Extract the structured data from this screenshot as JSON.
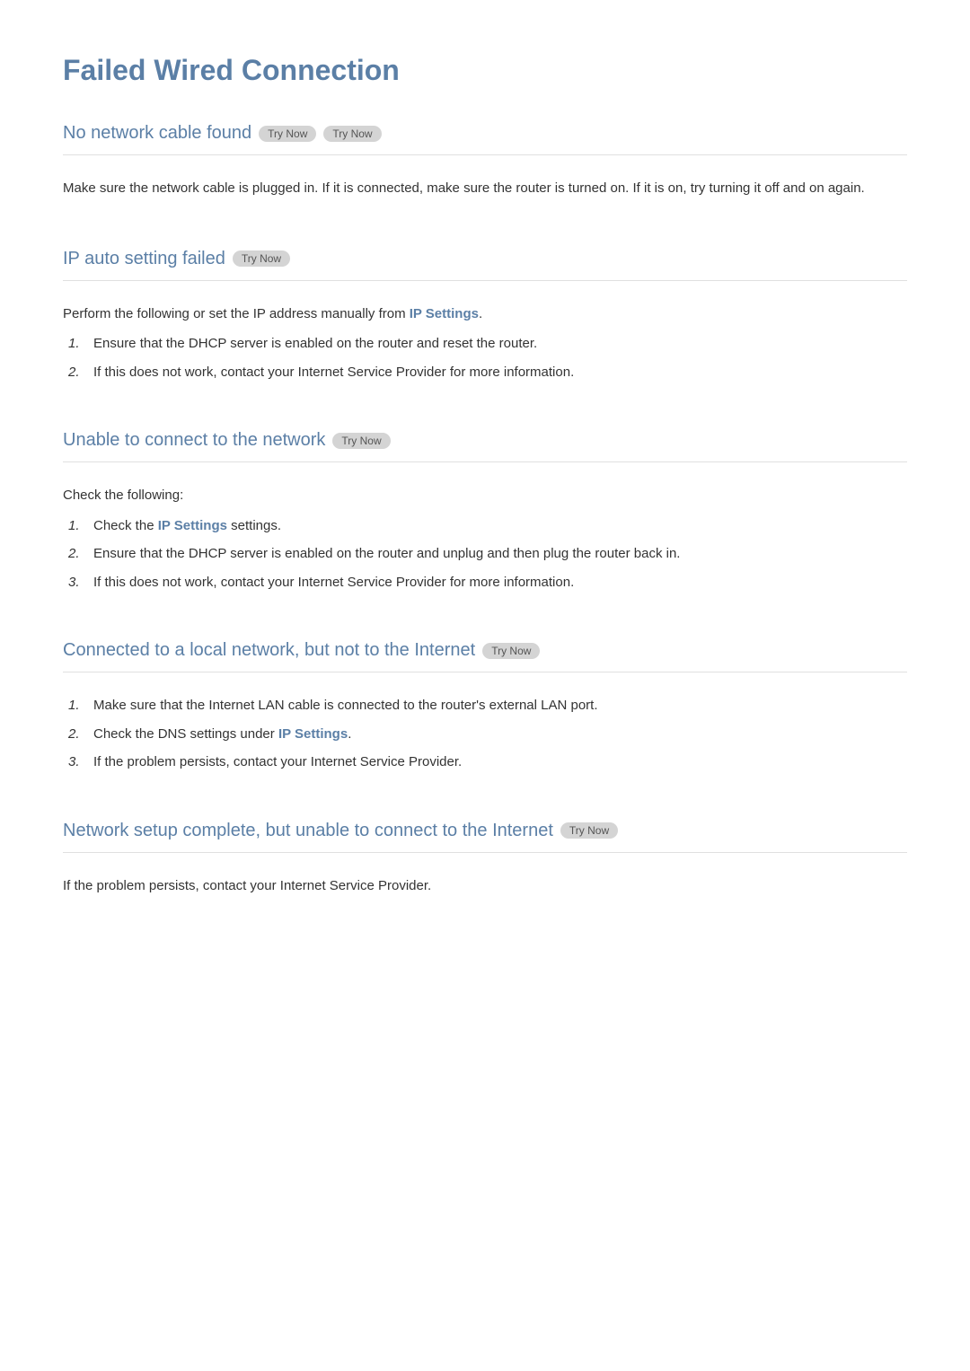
{
  "page": {
    "title": "Failed Wired Connection"
  },
  "sections": [
    {
      "id": "no-cable",
      "heading": "No network cable found",
      "try_now_buttons": 2,
      "body_type": "paragraph",
      "paragraph": "Make sure the network cable is plugged in. If it is connected, make sure the router is turned on. If it is on, try turning it off and on again."
    },
    {
      "id": "ip-auto-failed",
      "heading": "IP auto setting failed",
      "try_now_buttons": 1,
      "body_type": "list_with_intro",
      "intro": "Perform the following or set the IP address manually from",
      "intro_link": "IP Settings",
      "intro_suffix": ".",
      "items": [
        "Ensure that the DHCP server is enabled on the router and reset the router.",
        "If this does not work, contact your Internet Service Provider for more information."
      ]
    },
    {
      "id": "unable-to-connect",
      "heading": "Unable to connect to the network",
      "try_now_buttons": 1,
      "body_type": "list_with_intro",
      "intro": "Check the following:",
      "items_with_links": [
        {
          "text_before": "Check the ",
          "link": "IP Settings",
          "text_after": " settings."
        },
        {
          "text_before": "Ensure that the DHCP server is enabled on the router and unplug and then plug the router back in.",
          "link": null,
          "text_after": ""
        },
        {
          "text_before": "If this does not work, contact your Internet Service Provider for more information.",
          "link": null,
          "text_after": ""
        }
      ]
    },
    {
      "id": "connected-local",
      "heading": "Connected to a local network, but not to the Internet",
      "try_now_buttons": 1,
      "body_type": "list_with_links",
      "items_with_links": [
        {
          "text_before": "Make sure that the Internet LAN cable is connected to the router's external LAN port.",
          "link": null,
          "text_after": ""
        },
        {
          "text_before": "Check the DNS settings under ",
          "link": "IP Settings",
          "text_after": "."
        },
        {
          "text_before": "If the problem persists, contact your Internet Service Provider.",
          "link": null,
          "text_after": ""
        }
      ]
    },
    {
      "id": "setup-complete",
      "heading": "Network setup complete, but unable to connect to the Internet",
      "try_now_buttons": 1,
      "body_type": "paragraph",
      "paragraph": "If the problem persists, contact your Internet Service Provider."
    }
  ],
  "labels": {
    "try_now": "Try Now",
    "ip_settings": "IP Settings"
  }
}
